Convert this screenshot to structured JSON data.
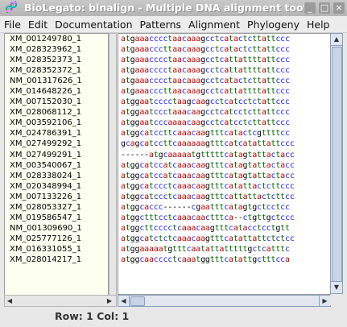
{
  "window": {
    "title": "BioLegato: blnalign - Multiple DNA alignment tool",
    "icon": "dna-app-icon"
  },
  "menu": [
    "File",
    "Edit",
    "Documentation",
    "Patterns",
    "Alignment",
    "Phylogeny",
    "Help"
  ],
  "names": [
    "XM_001249780_1",
    "XM_028323962_1",
    "XM_028352373_1",
    "XM_028352372_1",
    "NM_001317626_1",
    "XM_014648226_1",
    "XM_007152030_1",
    "XM_028068112_1",
    "XM_003592106_1",
    "XM_024786391_1",
    "XM_027499292_1",
    "XM_027499291_1",
    "XM_003540067_1",
    "XM_028338024_1",
    "XM_020348994_1",
    "XM_007133226_1",
    "XM_028053327_1",
    "XM_019586547_1",
    "NM_001309690_1",
    "XM_025777126_1",
    "XM_016331055_1",
    "XM_028014217_1"
  ],
  "sequences": [
    "atgaaacccctaacaaagcctcatactcttattccc",
    "atgaaacccttaacaaagcctcatactcttattccc",
    "atgaaacccctaacaaagcctcattattttattccc",
    "atgaaacccctaacaaagcctcattattttattccc",
    "atgaaacccctaacaaagcctcatactcttattccc",
    "atgaaacccttaacaaagcctcattattttattccc",
    "atggaatcccctaagcaagcctcatcctctattccc",
    "atggaatccctaaacaagcctcatcctcttattccc",
    "atggaatcccaaaacaagcctcatcctcttattccc",
    "atggcatccttcaaacaagtttcatactcgttttcc",
    "gcagcatccttcaaaaaagtttcatcatattattccc",
    "------atgcaaaaatgtttttcatagtattactacc",
    "atggcatccatcaaacaagtttcatagtattactacc",
    "atggcatccatcaaacaagtttcatagtattactacc",
    "atggcatccctcaaacaagtttcatattactcttccc",
    "atggcatccctcaaacaagtttcattattactcttcc",
    "atggcaccc------cgaatttcatagtgctcctcc",
    "atggctttcctcaaacaactttca--ctgttgctccc",
    "atggcttcccctcaaacaagtttcatacctcctgtt",
    "atggcatctctcaaacaagtttcatattattctctcc",
    "atggaaaaatgtttcaatattatttttgctcatttc",
    "atggcaacccctcaaatggtttcatattgctttcca"
  ],
  "status": {
    "label": "Row: 1 Col: 1"
  }
}
